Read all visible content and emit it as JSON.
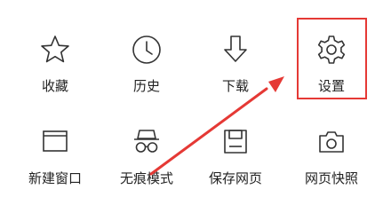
{
  "menu": {
    "items": [
      {
        "id": "favorites",
        "label": "收藏",
        "icon": "star-icon"
      },
      {
        "id": "history",
        "label": "历史",
        "icon": "clock-icon"
      },
      {
        "id": "download",
        "label": "下载",
        "icon": "download-arrow-icon"
      },
      {
        "id": "settings",
        "label": "设置",
        "icon": "gear-icon"
      },
      {
        "id": "new-window",
        "label": "新建窗口",
        "icon": "window-icon"
      },
      {
        "id": "incognito",
        "label": "无痕模式",
        "icon": "incognito-icon"
      },
      {
        "id": "save-page",
        "label": "保存网页",
        "icon": "floppy-disk-icon"
      },
      {
        "id": "screenshot",
        "label": "网页快照",
        "icon": "camera-icon"
      }
    ]
  },
  "annotation": {
    "highlight_color": "#e53935",
    "highlighted_item": "settings"
  }
}
